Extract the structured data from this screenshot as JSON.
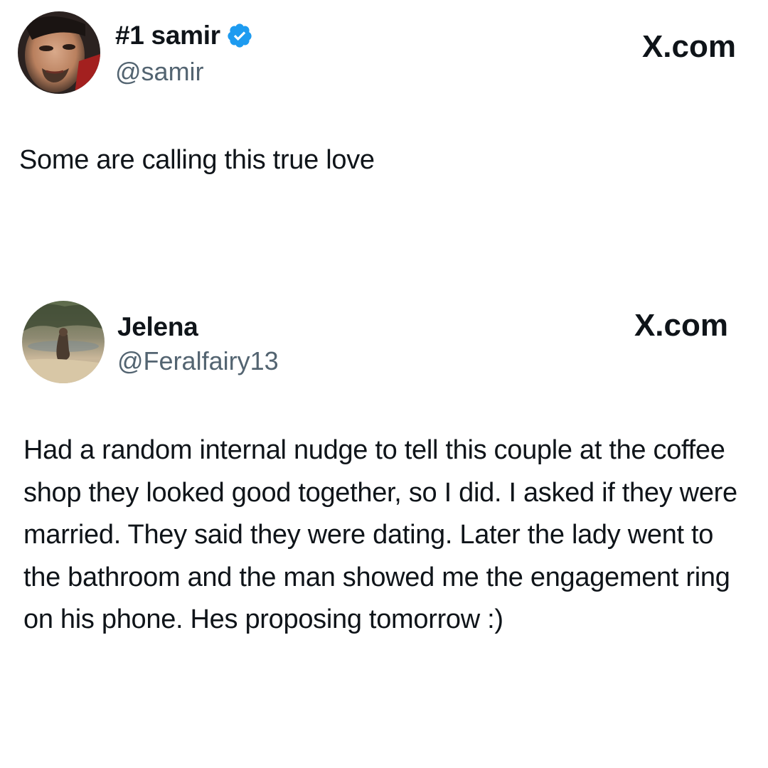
{
  "posts": [
    {
      "display_name": "#1 samir",
      "verified": true,
      "handle": "@samir",
      "brand": "X.com",
      "text": "Some are calling this true love",
      "avatar_icon": "profile-photo-man",
      "verified_color": "#1d9bf0"
    },
    {
      "display_name": "Jelena",
      "verified": false,
      "handle": "@Feralfairy13",
      "brand": "X.com",
      "text": "Had a random internal nudge to tell this couple at the coffee shop they looked good together, so I did. I asked if they were married. They said they were dating. Later the lady went to the bathroom and the man showed me the engagement ring on his phone. Hes proposing tomorrow :)",
      "avatar_icon": "profile-photo-outdoor"
    }
  ],
  "colors": {
    "text": "#0f1419",
    "handle": "#536471",
    "background": "#ffffff"
  }
}
